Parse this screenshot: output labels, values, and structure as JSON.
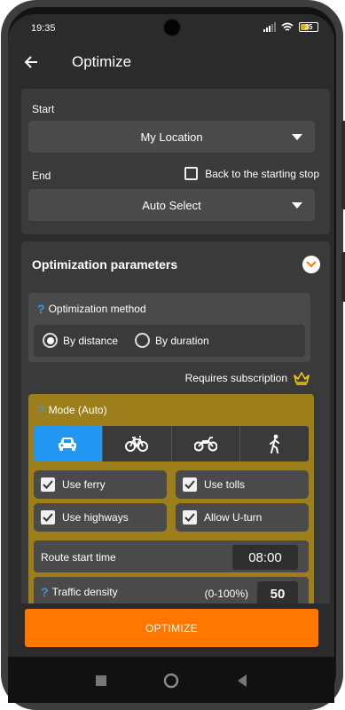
{
  "status_bar": {
    "time": "19:35",
    "battery": "35"
  },
  "app_bar": {
    "title": "Optimize"
  },
  "route": {
    "start_label": "Start",
    "start_value": "My Location",
    "end_label": "End",
    "back_to_start_label": "Back to the starting stop",
    "back_to_start_checked": false,
    "end_value": "Auto Select"
  },
  "params": {
    "title": "Optimization parameters",
    "method": {
      "help_icon": "question-icon",
      "label": "Optimization method",
      "options": [
        {
          "label": "By distance",
          "selected": true
        },
        {
          "label": "By duration",
          "selected": false
        }
      ]
    },
    "subscription_label": "Requires subscription",
    "mode": {
      "label": "Mode (Auto)",
      "options": [
        {
          "icon": "car-icon",
          "active": true
        },
        {
          "icon": "bicycle-icon",
          "active": false
        },
        {
          "icon": "motorcycle-icon",
          "active": false
        },
        {
          "icon": "walking-icon",
          "active": false
        }
      ]
    },
    "options": {
      "use_ferry": {
        "label": "Use ferry",
        "checked": true
      },
      "use_tolls": {
        "label": "Use tolls",
        "checked": true
      },
      "use_highways": {
        "label": "Use highways",
        "checked": true
      },
      "allow_uturn": {
        "label": "Allow U-turn",
        "checked": true
      }
    },
    "route_start_time": {
      "label": "Route start time",
      "value": "08:00"
    },
    "traffic_density": {
      "label": "Traffic density",
      "range": "(0-100%)",
      "value": "50"
    }
  },
  "optimize_button": "OPTIMIZE",
  "colors": {
    "accent": "#ff7700",
    "active_mode": "#2196f3",
    "premium": "#9c7f1a",
    "help": "#3a9ad9"
  }
}
